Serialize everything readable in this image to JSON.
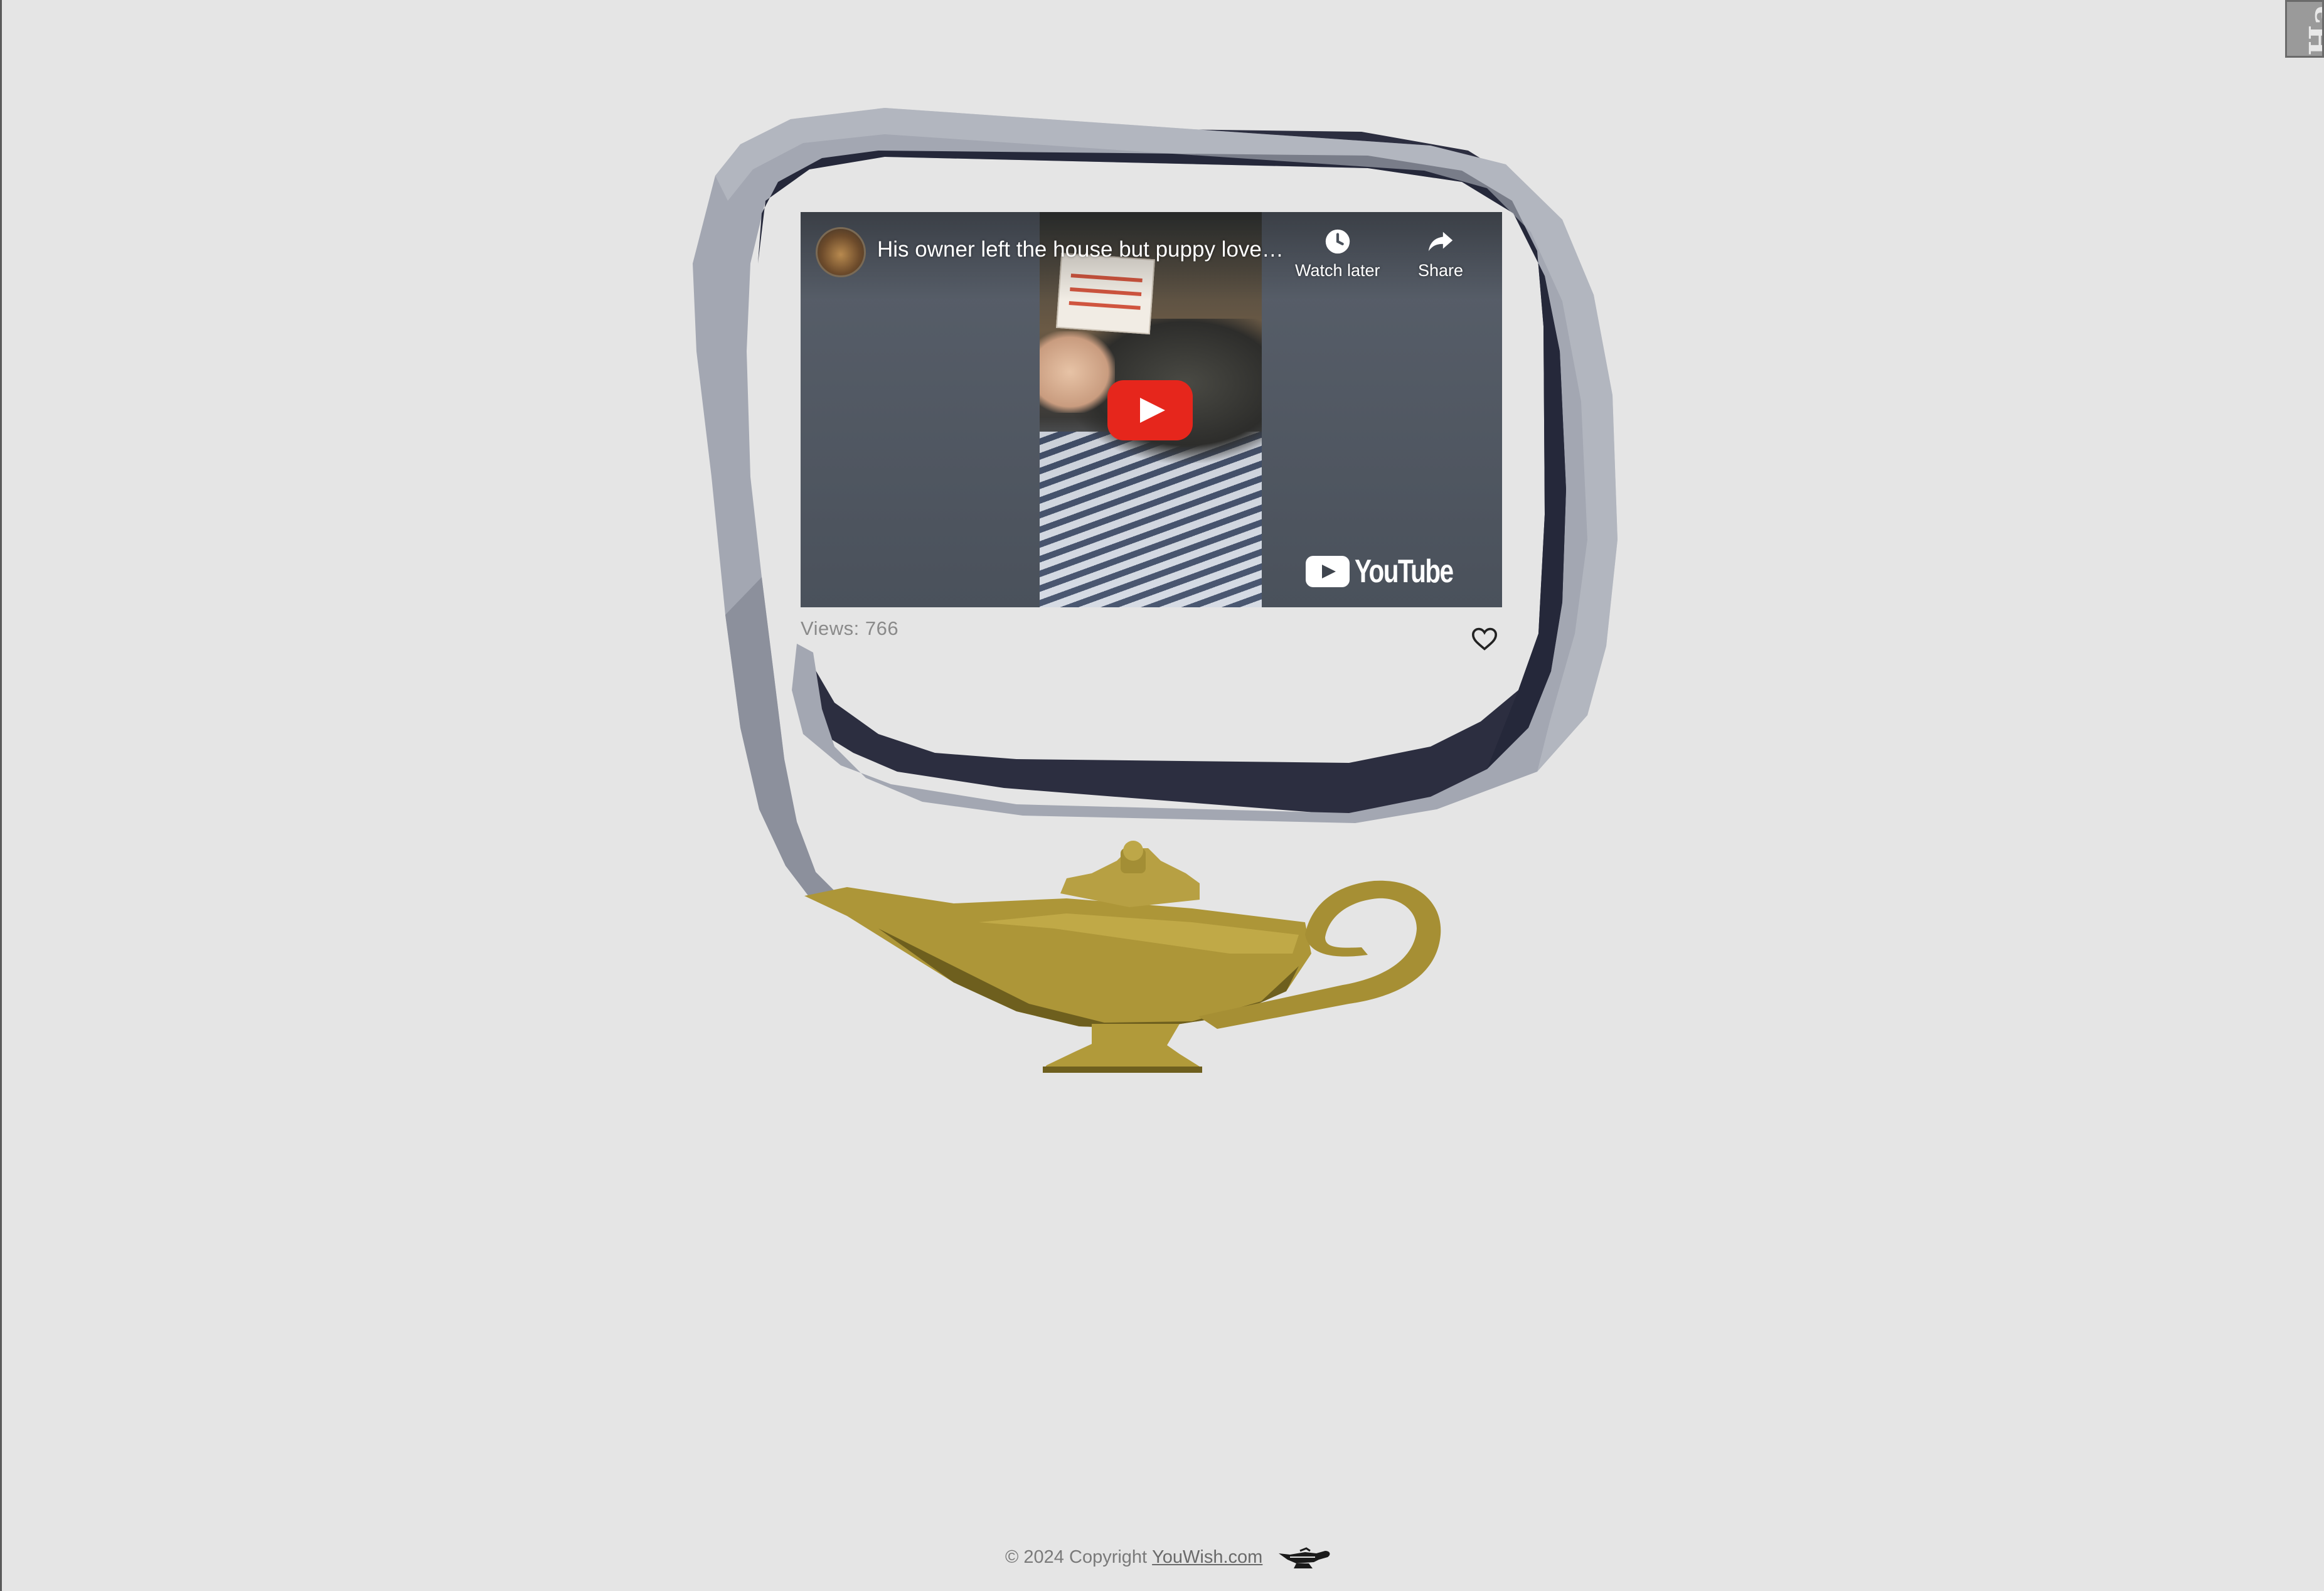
{
  "video": {
    "title": "His owner left the house but puppy love…",
    "watch_later_label": "Watch later",
    "share_label": "Share",
    "brand": "YouTube",
    "views_text": "Views: 766"
  },
  "footer": {
    "copyright": "© 2024 Copyright",
    "link_text": "YouWish.com"
  },
  "icons": {
    "watch_later": "clock-icon",
    "share": "share-arrow-icon",
    "like": "heart-icon",
    "play": "play-icon",
    "footer_logo": "genie-lamp-icon"
  },
  "colors": {
    "background": "#e5e5e5",
    "play_button": "#e6261c",
    "lamp_gold": "#b19a3a",
    "smoke_frame": "#a4a8b3",
    "smoke_shadow": "#2a2c3d"
  }
}
